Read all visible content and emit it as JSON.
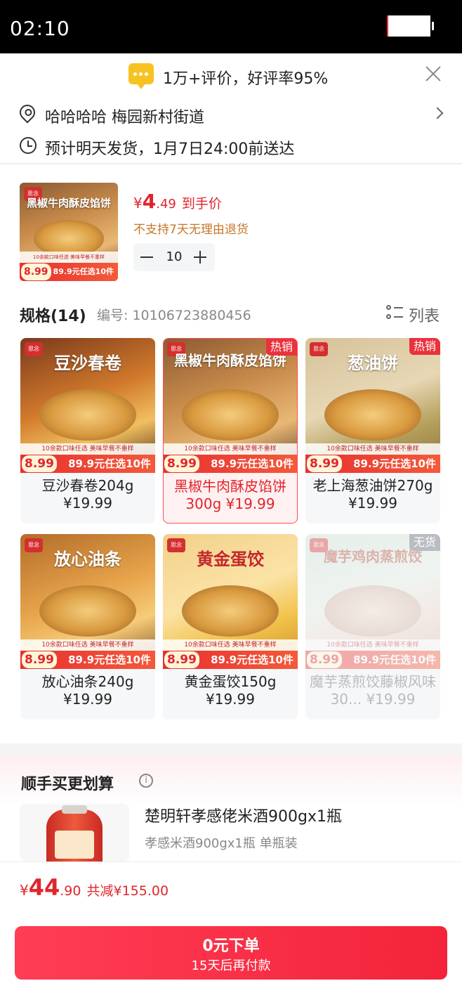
{
  "status_bar": {
    "time": "02:10"
  },
  "rating_bar": {
    "text": "1万+评价，好评率95%"
  },
  "address": {
    "text": "哈哈哈哈  梅园新村街道"
  },
  "delivery": {
    "text": "预计明天发货，1月7日24:00前送达"
  },
  "selected": {
    "image_title": "黑椒牛肉酥皮馅饼",
    "currency": "¥",
    "price_int": "4",
    "price_dec": ".49",
    "price_tag": "到手价",
    "note": "不支持7天无理由退货",
    "quantity": "10"
  },
  "promo": {
    "price": "8.99",
    "deal": "89.9元任选10件",
    "band": "10余款口味任选 美味早餐不重样",
    "logo": "思念"
  },
  "spec": {
    "title": "规格(14)",
    "code": "编号: 10106723880456",
    "list_label": "列表",
    "items": [
      {
        "image_title": "豆沙春卷",
        "name": "豆沙春卷204g ¥19.99",
        "badge": ""
      },
      {
        "image_title": "黑椒牛肉酥皮馅饼",
        "name": "黑椒牛肉酥皮馅饼300g ¥19.99",
        "badge": "热销"
      },
      {
        "image_title": "葱油饼",
        "name": "老上海葱油饼270g ¥19.99",
        "badge": "热销"
      },
      {
        "image_title": "放心油条",
        "name": "放心油条240g ¥19.99",
        "badge": ""
      },
      {
        "image_title": "黄金蛋饺",
        "name": "黄金蛋饺150g ¥19.99",
        "badge": ""
      },
      {
        "image_title": "魔芋鸡肉蒸煎饺",
        "name": "魔芋蒸煎饺藤椒风味30... ¥19.99",
        "badge": "无货"
      }
    ]
  },
  "upsell": {
    "title": "顺手买更划算",
    "product_name": "楚明轩孝感佬米酒900gx1瓶",
    "product_sub": "孝感米酒900gx1瓶 单瓶装"
  },
  "footer": {
    "currency": "¥",
    "total_int": "44",
    "total_dec": ".90",
    "saving": "共减¥155.00",
    "order_label": "0元下单",
    "order_sub": "15天后再付款"
  },
  "colors": {
    "accent": "#e0252c",
    "button": "#ff3d55",
    "hot_badge": "#e9323c"
  }
}
